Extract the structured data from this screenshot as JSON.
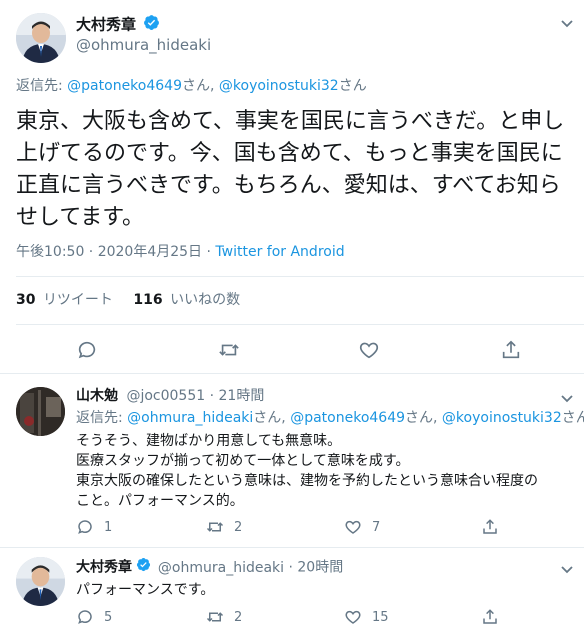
{
  "colors": {
    "link": "#1b95e0",
    "muted": "#657786",
    "text": "#14171a",
    "verified": "#1da1f2",
    "divider": "#e6ecf0"
  },
  "main_tweet": {
    "author_name": "大村秀章",
    "author_handle": "@ohmura_hideaki",
    "reply_prefix": "返信先:",
    "reply_to_1": "@patoneko4649",
    "reply_sep_1": "さん, ",
    "reply_to_2": "@koyoinostuki32",
    "reply_sep_2": "さん",
    "text": "東京、大阪も含めて、事実を国民に言うべきだ。と申し上げてるのです。今、国も含めて、もっと事実を国民に正直に言うべきです。もちろん、愛知は、すべてお知らせしてます。",
    "time": "午後10:50 · 2020年4月25日",
    "source_sep": " · ",
    "source": "Twitter for Android",
    "retweet_count": "30",
    "retweet_label": "リツイート",
    "like_count": "116",
    "like_label": "いいねの数"
  },
  "replies": [
    {
      "author_name": "山木勉",
      "author_handle": "@joc00551",
      "time": "· 21時間",
      "reply_prefix": "返信先:",
      "reply_to_1": "@ohmura_hideaki",
      "reply_sep_1": "さん, ",
      "reply_to_2": "@patoneko4649",
      "reply_sep_2": "さん, ",
      "reply_to_3": "@koyoinostuki32",
      "reply_sep_3": "さん",
      "text_lines": [
        "そうそう、建物ばかり用意しても無意味。",
        "医療スタッフが揃って初めて一体として意味を成す。",
        "東京大阪の確保したという意味は、建物を予約したという意味合い程度の",
        "こと。パフォーマンス的。"
      ],
      "reply_count": "1",
      "retweet_count": "2",
      "like_count": "7"
    },
    {
      "author_name": "大村秀章",
      "author_handle": "@ohmura_hideaki",
      "time": "· 20時間",
      "text": "パフォーマンスです。",
      "reply_count": "5",
      "retweet_count": "2",
      "like_count": "15"
    }
  ],
  "icons": [
    "verified-badge-icon",
    "chevron-down-icon",
    "reply-icon",
    "retweet-icon",
    "like-icon",
    "share-icon"
  ]
}
